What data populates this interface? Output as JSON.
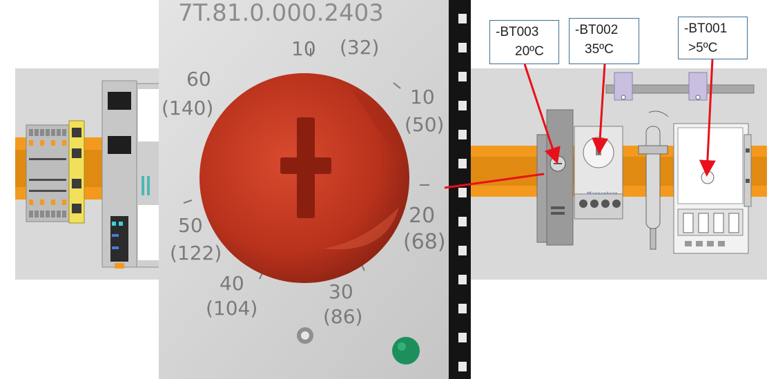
{
  "photo": {
    "part_number": "7T.81.0.000.2403",
    "dial_marks": [
      {
        "c": "10",
        "f": "(32)"
      },
      {
        "c": "10",
        "f": "(50)"
      },
      {
        "c": "20",
        "f": "(68)"
      },
      {
        "c": "30",
        "f": "(86)"
      },
      {
        "c": "40",
        "f": "(104)"
      },
      {
        "c": "50",
        "f": "(122)"
      },
      {
        "c": "60",
        "f": "(140)"
      }
    ]
  },
  "callouts": [
    {
      "tag": "-BT003",
      "value": "20ºC"
    },
    {
      "tag": "-BT002",
      "value": "35ºC"
    },
    {
      "tag": "-BT001",
      "value": ">5ºC"
    }
  ],
  "colors": {
    "background": "#d9d9d9",
    "din_rail": "#f39a1e",
    "knob": "#c83a22",
    "arrow": "#e8101a",
    "callout_border": "#3c6e8f"
  }
}
